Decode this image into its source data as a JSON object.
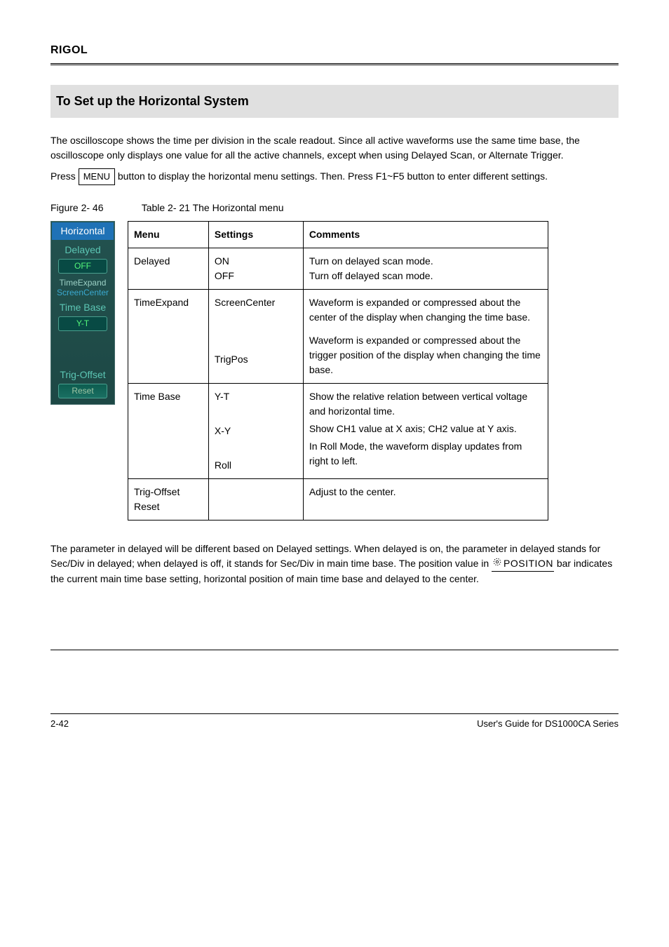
{
  "header": {
    "brand": "RIGOL"
  },
  "section": {
    "title": "To Set up the Horizontal System"
  },
  "intro": {
    "line1": "The oscilloscope shows the time per division in the scale readout. Since all active waveforms use the same time base, the oscilloscope only displays one value for all the active channels, except when using Delayed Scan, or Alternate Trigger.",
    "line2_pre": "Press ",
    "line2_btn": "MENU",
    "line2_post": " button to display the horizontal menu settings. Then. Press F1~F5 button to enter different settings."
  },
  "figlabels": {
    "figure": "Figure 2- 46",
    "table": "Table 2- 21 The Horizontal menu"
  },
  "softmenu": {
    "title": "Horizontal",
    "delayed": "Delayed",
    "off": "OFF",
    "timeexpand": "TimeExpand",
    "screencenter": "ScreenCenter",
    "timebase": "Time Base",
    "yt": "Y-T",
    "trigoffset": "Trig-Offset",
    "reset": "Reset"
  },
  "table": {
    "head": {
      "menu": "Menu",
      "settings": "Settings",
      "comments": "Comments"
    },
    "row1": {
      "menu": "Delayed",
      "set_on": "ON",
      "set_off": "OFF",
      "comm_on": "Turn on delayed scan mode.",
      "comm_off": "Turn off delayed scan mode."
    },
    "row2": {
      "menu": "TimeExpand",
      "set_sc": "ScreenCenter",
      "set_tp": "TrigPos",
      "comm_sc": "Waveform is expanded or compressed about the center of the display when changing the time base.",
      "comm_tp": "Waveform is expanded or compressed about the trigger position of the display when changing the time base."
    },
    "row3": {
      "menu": "Time Base",
      "set_yt": "Y-T",
      "set_xy": "X-Y",
      "set_roll": "Roll",
      "comm_yt": "Show the relative relation between vertical voltage and horizontal time.",
      "comm_xy": "Show CH1 value at X axis; CH2 value at Y axis.",
      "comm_roll": "In Roll Mode, the waveform display updates from right to left."
    },
    "row4": {
      "menu": "Trig-Offset Reset",
      "comm": "Adjust to the center."
    }
  },
  "paragraph": {
    "pre": "The parameter in delayed will be different based on Delayed settings. When delayed is on, the parameter in delayed stands for Sec/Div in delayed; when delayed is off, it stands for Sec/Div in main time base. The position value in ",
    "knob": "POSITION",
    "post": " bar indicates the current main time base setting, horizontal position of main time base and delayed to the center."
  },
  "footer": {
    "page": "2-42",
    "doc": "User's Guide for DS1000CA Series"
  }
}
